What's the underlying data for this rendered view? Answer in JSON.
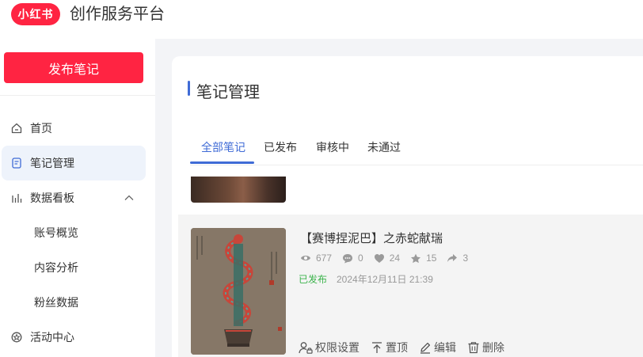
{
  "header": {
    "logo_text": "小红书",
    "app_title": "创作服务平台",
    "brand_color": "#ff2442"
  },
  "sidebar": {
    "publish_label": "发布笔记",
    "items": [
      {
        "label": "首页",
        "icon": "home-icon"
      },
      {
        "label": "笔记管理",
        "icon": "note-icon",
        "active": true
      },
      {
        "label": "数据看板",
        "icon": "bar-chart-icon",
        "expanded": true
      },
      {
        "label": "账号概览"
      },
      {
        "label": "内容分析"
      },
      {
        "label": "粉丝数据"
      },
      {
        "label": "活动中心",
        "icon": "activity-icon"
      }
    ]
  },
  "main": {
    "title": "笔记管理",
    "accent_color": "#3f6bd6",
    "tabs": [
      {
        "label": "全部笔记",
        "active": true
      },
      {
        "label": "已发布"
      },
      {
        "label": "审核中"
      },
      {
        "label": "未通过"
      }
    ],
    "note": {
      "title": "【赛博捏泥巴】之赤蛇献瑞",
      "stats": {
        "views": "677",
        "comments": "0",
        "likes": "24",
        "collects": "15",
        "shares": "3"
      },
      "status": "已发布",
      "date": "2024年12月11日 21:39",
      "actions": [
        "权限设置",
        "置顶",
        "编辑",
        "删除"
      ]
    }
  }
}
